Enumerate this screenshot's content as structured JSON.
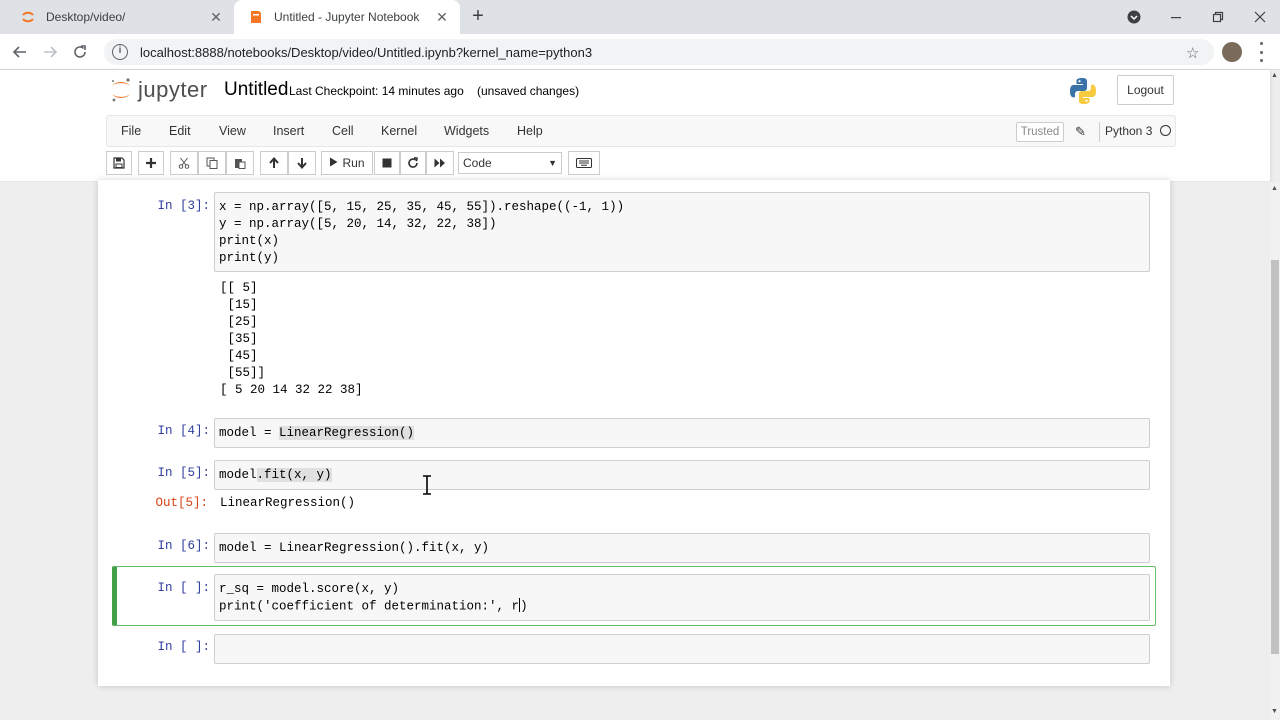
{
  "browser": {
    "tabs": [
      {
        "title": "Desktop/video/",
        "active": false
      },
      {
        "title": "Untitled - Jupyter Notebook",
        "active": true
      }
    ],
    "url": "localhost:8888/notebooks/Desktop/video/Untitled.ipynb?kernel_name=python3"
  },
  "jupyter": {
    "logo_text": "jupyter",
    "notebook_name": "Untitled",
    "checkpoint": "Last Checkpoint: 14 minutes ago",
    "autosave": "(unsaved changes)",
    "logout_label": "Logout",
    "menu": [
      "File",
      "Edit",
      "View",
      "Insert",
      "Cell",
      "Kernel",
      "Widgets",
      "Help"
    ],
    "trusted_label": "Trusted",
    "kernel_name": "Python 3",
    "run_label": "Run",
    "cell_type": "Code",
    "accent_color": "#42a047"
  },
  "cells": [
    {
      "prompt": "In [3]:",
      "code": "x = np.array([5, 15, 25, 35, 45, 55]).reshape((-1, 1))\ny = np.array([5, 20, 14, 32, 22, 38])\nprint(x)\nprint(y)",
      "output": "[[ 5]\n [15]\n [25]\n [35]\n [45]\n [55]]\n[ 5 20 14 32 22 38]"
    },
    {
      "prompt": "In [4]:",
      "code_pre": "model = ",
      "code_hl": "LinearRegression()"
    },
    {
      "prompt": "In [5]:",
      "code_pre": "model",
      "code_hl": ".fit(x, y)",
      "out_prompt": "Out[5]:",
      "output": "LinearRegression()"
    },
    {
      "prompt": "In [6]:",
      "code": "model = LinearRegression().fit(x, y)"
    },
    {
      "prompt": "In [ ]:",
      "line1": "r_sq = model.score(x, y)",
      "line2_pre": "print('coefficient of determination:', r",
      "line2_post": ")"
    },
    {
      "prompt": "In [ ]:",
      "code": ""
    }
  ]
}
